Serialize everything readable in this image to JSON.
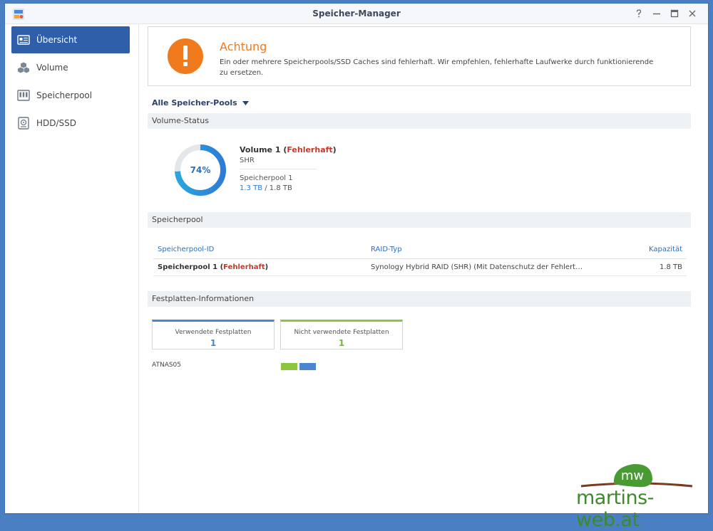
{
  "window": {
    "title": "Speicher-Manager"
  },
  "sidebar": {
    "items": [
      {
        "label": "Übersicht",
        "icon": "overview-card-icon",
        "active": true
      },
      {
        "label": "Volume",
        "icon": "cubes-icon"
      },
      {
        "label": "Speicherpool",
        "icon": "storage-pool-icon"
      },
      {
        "label": "HDD/SSD",
        "icon": "hard-drive-icon"
      }
    ]
  },
  "alert": {
    "title": "Achtung",
    "text": "Ein oder mehrere Speicherpools/SSD Caches sind fehlerhaft. Wir empfehlen, fehlerhafte Laufwerke durch funktionierende zu ersetzen.",
    "icon": "exclamation-icon",
    "color": "#f07a1c"
  },
  "pool_filter": {
    "label": "Alle Speicher-Pools"
  },
  "volume_status": {
    "heading": "Volume-Status",
    "percent": 74,
    "percent_label": "74%",
    "name": "Volume 1",
    "state": "Fehlerhaft",
    "type": "SHR",
    "pool": "Speicherpool 1",
    "used": "1.3 TB",
    "separator": " / ",
    "total": "1.8 TB"
  },
  "pool_section": {
    "heading": "Speicherpool",
    "columns": [
      "Speicherpool-ID",
      "RAID-Typ",
      "Kapazität"
    ],
    "rows": [
      {
        "name": "Speicherpool 1",
        "state": "Fehlerhaft",
        "raid": "Synology Hybrid RAID (SHR) (Mit Datenschutz der Fehlert…",
        "capacity": "1.8 TB"
      }
    ]
  },
  "disk_section": {
    "heading": "Festplatten-Informationen",
    "used_label": "Verwendete Festplatten",
    "used_count": "1",
    "unused_label": "Nicht verwendete Festplatten",
    "unused_count": "1",
    "host": "ATNAS05",
    "used_color": "#4a86d0",
    "unused_color": "#8cc63f"
  },
  "watermark": {
    "badge": "mw",
    "text": "martins-web.at"
  }
}
